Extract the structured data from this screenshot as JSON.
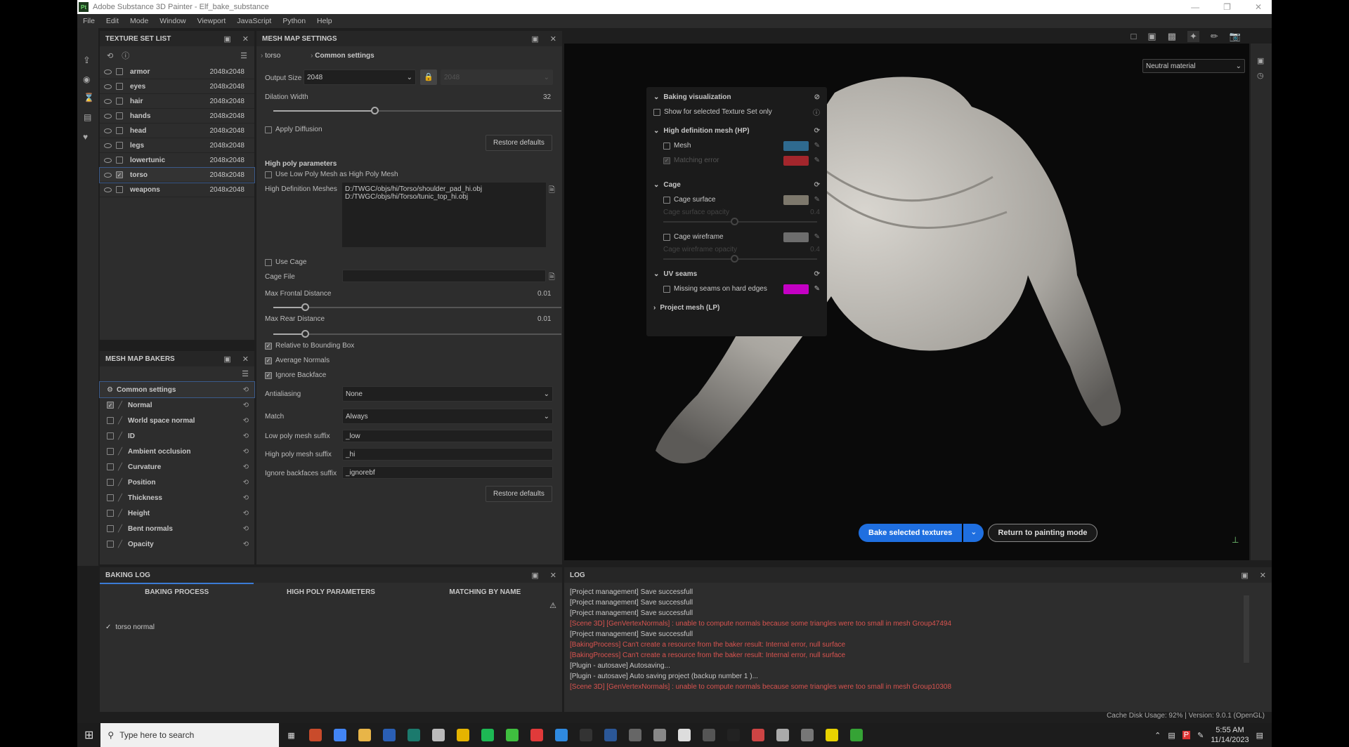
{
  "window": {
    "title": "Adobe Substance 3D Painter - Elf_bake_substance",
    "app_icon": "Pt"
  },
  "menu": [
    "File",
    "Edit",
    "Mode",
    "Window",
    "Viewport",
    "JavaScript",
    "Python",
    "Help"
  ],
  "texture_set_list": {
    "title": "TEXTURE SET LIST",
    "items": [
      {
        "name": "armor",
        "size": "2048x2048",
        "checked": false
      },
      {
        "name": "eyes",
        "size": "2048x2048",
        "checked": false
      },
      {
        "name": "hair",
        "size": "2048x2048",
        "checked": false
      },
      {
        "name": "hands",
        "size": "2048x2048",
        "checked": false
      },
      {
        "name": "head",
        "size": "2048x2048",
        "checked": false
      },
      {
        "name": "legs",
        "size": "2048x2048",
        "checked": false
      },
      {
        "name": "lowertunic",
        "size": "2048x2048",
        "checked": false
      },
      {
        "name": "torso",
        "size": "2048x2048",
        "checked": true,
        "selected": true
      },
      {
        "name": "weapons",
        "size": "2048x2048",
        "checked": false
      }
    ]
  },
  "mesh_map_bakers": {
    "title": "MESH MAP BAKERS",
    "items": [
      {
        "name": "Common settings",
        "checked": null,
        "selected": true
      },
      {
        "name": "Normal",
        "checked": true
      },
      {
        "name": "World space normal",
        "checked": false
      },
      {
        "name": "ID",
        "checked": false
      },
      {
        "name": "Ambient occlusion",
        "checked": false
      },
      {
        "name": "Curvature",
        "checked": false
      },
      {
        "name": "Position",
        "checked": false
      },
      {
        "name": "Thickness",
        "checked": false
      },
      {
        "name": "Height",
        "checked": false
      },
      {
        "name": "Bent normals",
        "checked": false
      },
      {
        "name": "Opacity",
        "checked": false
      }
    ]
  },
  "mesh_map_settings": {
    "title": "MESH MAP SETTINGS",
    "breadcrumb": [
      "torso",
      "Common settings"
    ],
    "output_size_label": "Output Size",
    "output_size": "2048",
    "output_size_2": "2048",
    "dilation_label": "Dilation Width",
    "dilation_value": "32",
    "dilation_fraction": 0.35,
    "apply_diffusion": "Apply Diffusion",
    "restore_defaults": "Restore defaults",
    "high_poly_header": "High poly parameters",
    "use_low_poly": "Use Low Poly Mesh as High Poly Mesh",
    "hd_meshes_label": "High Definition Meshes",
    "hd_meshes": [
      "D:/TWGC/objs/hi/Torso/shoulder_pad_hi.obj",
      "D:/TWGC/objs/hi/Torso/tunic_top_hi.obj"
    ],
    "use_cage": "Use Cage",
    "cage_file_label": "Cage File",
    "max_frontal_label": "Max Frontal Distance",
    "max_frontal_value": "0.01",
    "max_frontal_fraction": 0.11,
    "max_rear_label": "Max Rear Distance",
    "max_rear_value": "0.01",
    "max_rear_fraction": 0.11,
    "relative_bbox": "Relative to Bounding Box",
    "average_normals": "Average Normals",
    "ignore_backface": "Ignore Backface",
    "antialiasing_label": "Antialiasing",
    "antialiasing": "None",
    "match_label": "Match",
    "match": "Always",
    "low_suffix_label": "Low poly mesh suffix",
    "low_suffix": "_low",
    "high_suffix_label": "High poly mesh suffix",
    "high_suffix": "_hi",
    "ignore_suffix_label": "Ignore backfaces suffix",
    "ignore_suffix": "_ignorebf"
  },
  "viewport": {
    "material": "Neutral material",
    "bake_button": "Bake selected textures",
    "return_button": "Return to painting mode",
    "accent": "#1f6fe0"
  },
  "baking_visualization": {
    "title": "Baking visualization",
    "show_selected": "Show for selected Texture Set only",
    "hp_header": "High definition mesh (HP)",
    "mesh": "Mesh",
    "matching_error": "Matching error",
    "cage_header": "Cage",
    "cage_surface": "Cage surface",
    "cage_surface_opacity": "Cage surface opacity",
    "cage_surface_opacity_value": "0.4",
    "cage_wireframe": "Cage wireframe",
    "cage_wireframe_opacity": "Cage wireframe opacity",
    "cage_wireframe_opacity_value": "0.4",
    "uv_header": "UV seams",
    "missing_seams": "Missing seams on hard edges",
    "project_header": "Project mesh (LP)",
    "colors": {
      "mesh": "#2f6a8f",
      "matching_error": "#a3262c",
      "cage_surface": "#7d786c",
      "cage_wireframe": "#6d6d6d",
      "missing_seams": "#c400c4"
    }
  },
  "baking_log": {
    "title": "BAKING LOG",
    "tabs": [
      "BAKING PROCESS",
      "HIGH POLY PARAMETERS",
      "MATCHING BY NAME"
    ],
    "entries": [
      "torso normal"
    ]
  },
  "log": {
    "title": "LOG",
    "lines": [
      {
        "text": "[Project management] Save successfull",
        "error": false
      },
      {
        "text": "[Project management] Save successfull",
        "error": false
      },
      {
        "text": "[Project management] Save successfull",
        "error": false
      },
      {
        "text": "[Scene 3D] [GenVertexNormals] : unable to compute normals because some triangles were too small in mesh Group47494",
        "error": true
      },
      {
        "text": "[Project management] Save successfull",
        "error": false
      },
      {
        "text": "[BakingProcess] Can't create a resource from the baker result: Internal error, null surface",
        "error": true
      },
      {
        "text": "[BakingProcess] Can't create a resource from the baker result: Internal error, null surface",
        "error": true
      },
      {
        "text": "[Plugin - autosave] Autosaving...",
        "error": false
      },
      {
        "text": "[Plugin - autosave] Auto saving project (backup number 1 )...",
        "error": false
      },
      {
        "text": "[Scene 3D] [GenVertexNormals] : unable to compute normals because some triangles were too small in mesh Group10308",
        "error": true
      }
    ]
  },
  "status": "Cache Disk Usage:   92% | Version: 9.0.1 (OpenGL)",
  "taskbar": {
    "search_placeholder": "Type here to search",
    "time": "5:55 AM",
    "date": "11/14/2023"
  }
}
